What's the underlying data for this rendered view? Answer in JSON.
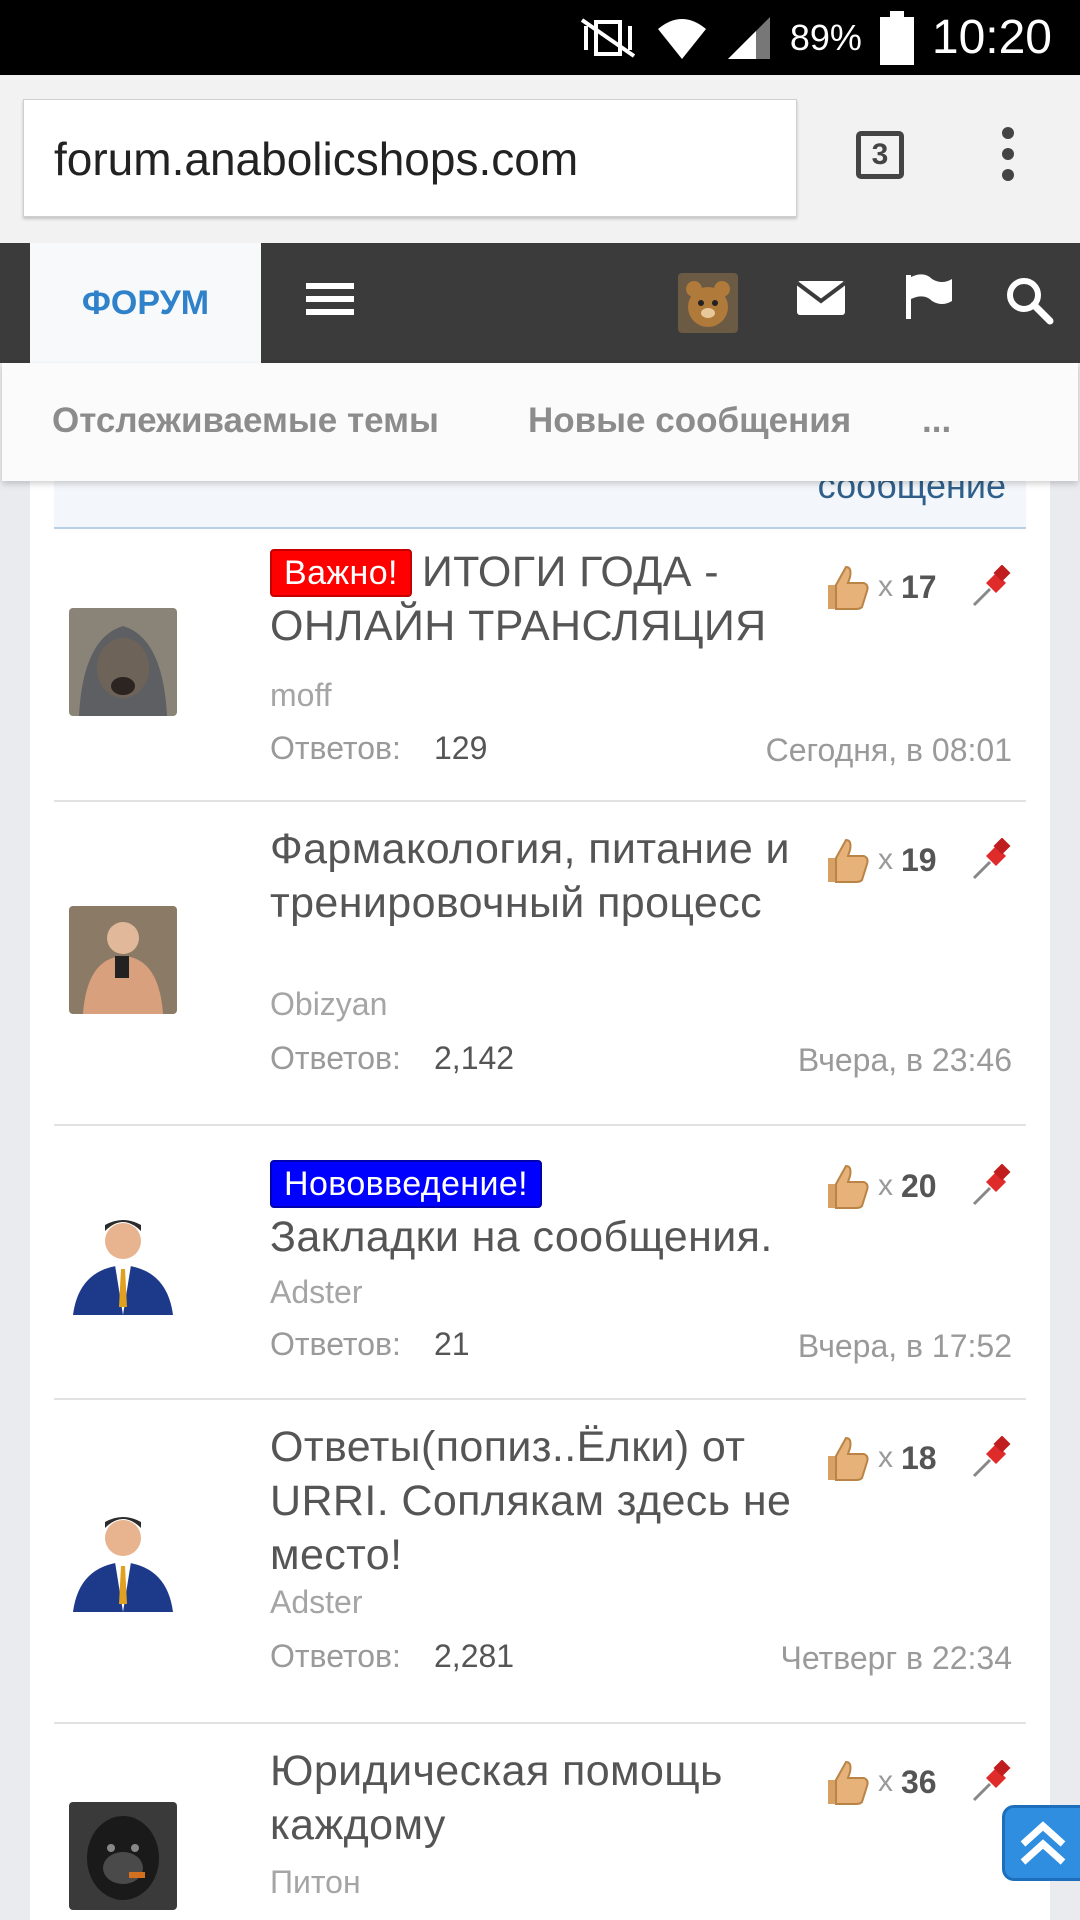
{
  "status_bar": {
    "battery": "89%",
    "time": "10:20"
  },
  "browser": {
    "url": "forum.anabolicshops.com",
    "tab_count": "3"
  },
  "nav": {
    "forum_tab": "ФОРУМ"
  },
  "sub_nav": {
    "watched": "Отслеживаемые темы",
    "new_posts": "Новые сообщения",
    "more": "..."
  },
  "partial_header": "сообщение",
  "replies_label": "Ответов:",
  "threads": [
    {
      "prefix": "Важно!",
      "title": "ИТОГИ ГОДА - ОНЛАЙН ТРАНСЛЯЦИЯ",
      "author": "moff",
      "replies": "129",
      "date": "Сегодня, в 08:01",
      "likes": "17"
    },
    {
      "prefix": "",
      "title": "Фармакология, питание и тренировочный процесс",
      "author": "Obizyan",
      "replies": "2,142",
      "date": "Вчера, в 23:46",
      "likes": "19"
    },
    {
      "prefix": "Нововведение!",
      "title": "Закладки на сообщения.",
      "author": "Adster",
      "replies": "21",
      "date": "Вчера, в 17:52",
      "likes": "20"
    },
    {
      "prefix": "",
      "title": "Ответы(попиз..Ёлки) от URRI. Соплякам здесь не место!",
      "author": "Adster",
      "replies": "2,281",
      "date": "Четверг в 22:34",
      "likes": "18"
    },
    {
      "prefix": "",
      "title": "Юридическая помощь каждому",
      "author": "Питон",
      "replies": "",
      "date": "",
      "likes": "36"
    }
  ],
  "colors": {
    "forum_blue": "#2f82c9",
    "important_red": "#ff0000",
    "new_blue": "#0000ff",
    "nav_dark": "#3b3b3b"
  },
  "icons": [
    "signal-mute-icon",
    "wifi-icon",
    "cell-signal-icon",
    "battery-icon",
    "tab-switcher-icon",
    "overflow-menu-icon",
    "hamburger-icon",
    "user-avatar",
    "mail-icon",
    "flag-icon",
    "search-icon",
    "thumbs-up-icon",
    "pin-icon",
    "scroll-top-icon"
  ]
}
